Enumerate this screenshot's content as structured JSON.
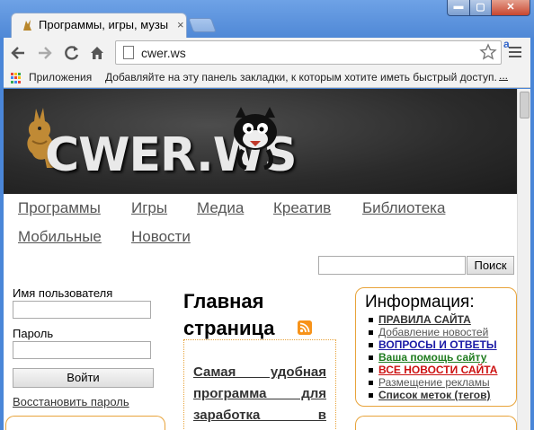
{
  "browser": {
    "tab_title": "Программы, игры, музы",
    "tab_close": "×",
    "window_controls": {
      "minimize": "▬",
      "maximize": "▢",
      "close": "✕"
    },
    "address": "cwer.ws",
    "extension_label": "a",
    "bookmarks": {
      "apps_label": "Приложения",
      "hint": "Добавляйте на эту панель закладки, к которым хотите иметь быстрый доступ.",
      "more": "..."
    },
    "icons": {
      "back": "back-arrow-icon",
      "forward": "forward-arrow-icon",
      "reload": "reload-icon",
      "home": "home-icon",
      "star": "star-icon",
      "menu": "hamburger-menu-icon"
    }
  },
  "site": {
    "logo": "CWER.WS",
    "nav_row1": [
      "Программы",
      "Игры",
      "Медиа",
      "Креатив",
      "Библиотека"
    ],
    "nav_row2": [
      "Мобильные",
      "Новости"
    ],
    "search_button": "Поиск",
    "login": {
      "username_label": "Имя пользователя",
      "password_label": "Пароль",
      "submit": "Войти",
      "restore": "Восстановить пароль"
    },
    "main_title": "Главная страница",
    "article_title": "Самая удобная программа для заработка в",
    "info": {
      "title": "Информация:",
      "items": [
        {
          "label": "ПРАВИЛА САЙТА",
          "color": "#333333"
        },
        {
          "label": "Добавление новостей",
          "color": "#555555"
        },
        {
          "label": "ВОПРОСЫ И ОТВЕТЫ",
          "color": "#1a1aa6"
        },
        {
          "label": "Ваша помощь сайту",
          "color": "#1e7b1e"
        },
        {
          "label": "ВСЕ НОВОСТИ САЙТА",
          "color": "#cc1111"
        },
        {
          "label": "Размещение рекламы",
          "color": "#555555"
        },
        {
          "label": "Список меток (тегов)",
          "color": "#333333"
        }
      ]
    },
    "accent_color": "#e8a33a"
  }
}
